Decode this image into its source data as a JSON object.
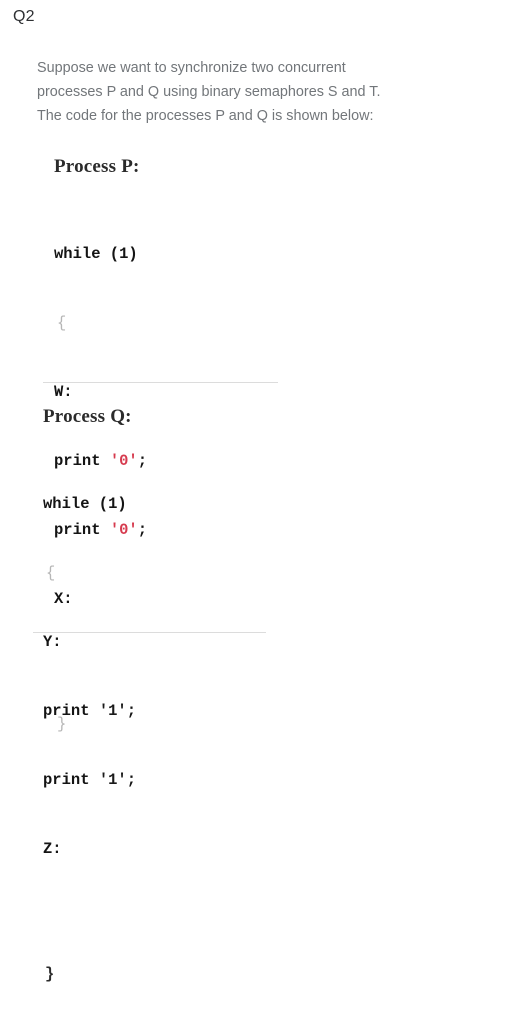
{
  "question": {
    "number": "Q2",
    "prompt": "Suppose we want to synchronize two concurrent processes P and Q using binary semaphores S and T. The code for the processes P and Q is shown below:"
  },
  "colors": {
    "page_background": "#ffffff",
    "question_number": "#2e3033",
    "prompt_text": "#72767a",
    "code_text": "#141414",
    "string_literal_red": "#d63a4e",
    "brace_gray": "#b6b6b6",
    "divider": "#dcdcdc"
  },
  "process_p": {
    "title": "Process P:",
    "lines": {
      "while": "while (1)",
      "open_brace": "{",
      "label_w": "W:",
      "print_kw_1": "print ",
      "literal_1": "'0'",
      "semicolon_1": ";",
      "print_kw_2": "print ",
      "literal_2": "'0'",
      "semicolon_2": ";",
      "label_x": "X:",
      "close_brace": "}"
    }
  },
  "process_q": {
    "title": "Process Q:",
    "lines": {
      "while": "while (1)",
      "open_brace": "{",
      "label_y": "Y:",
      "print_kw_1": "print ",
      "literal_1": "'1'",
      "semicolon_1": ";",
      "print_kw_2": "print ",
      "literal_2": "'1'",
      "semicolon_2": ";",
      "label_z": "Z:",
      "close_brace": "}"
    }
  }
}
